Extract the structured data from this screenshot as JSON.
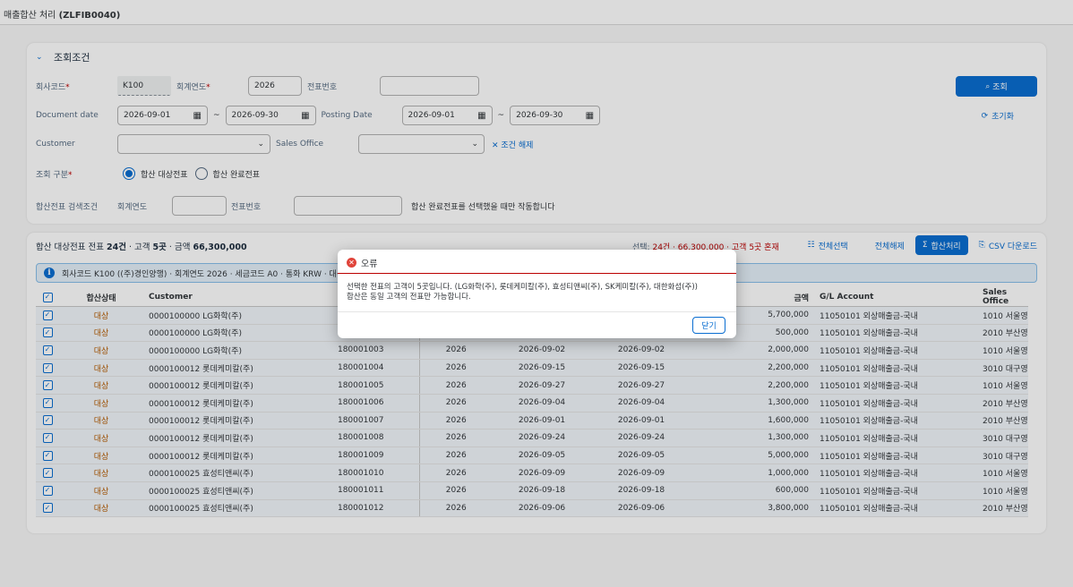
{
  "app": {
    "title_prefix": "매출합산 처리 ",
    "title_code": "(ZLFIB0040)"
  },
  "filter": {
    "section_title": "조회조건",
    "company_code": {
      "label": "회사코드",
      "value": "K100"
    },
    "fiscal_year": {
      "label": "회계연도",
      "value": "2026"
    },
    "doc_number": {
      "label": "전표번호",
      "value": ""
    },
    "document_date": {
      "label": "Document date",
      "from": "2026-09-01",
      "to": "2026-09-30"
    },
    "posting_date": {
      "label": "Posting Date",
      "from": "2026-09-01",
      "to": "2026-09-30"
    },
    "customer": {
      "label": "Customer",
      "value": ""
    },
    "sales_office": {
      "label": "Sales Office",
      "value": ""
    },
    "clear_label": "조건 해제",
    "inquiry_type": {
      "label": "조회 구분",
      "option1": "합산 대상전표",
      "option2": "합산 완료전표",
      "selected": "합산 대상전표"
    },
    "summed_search": {
      "label": "합산전표 검색조건",
      "year_label": "회계연도",
      "doc_label": "전표번호",
      "hint": "합산 완료전표를 선택했을 때만 작동합니다"
    },
    "search_button": "조회",
    "reset_button": "초기화"
  },
  "table": {
    "title": "합산 대상전표",
    "summary_prefix": "전표 ",
    "summary_count": "24건",
    "summary_mid": " · 고객 ",
    "summary_customers": "5곳",
    "summary_amount_prefix": " · 금액 ",
    "summary_amount": "66,300,000",
    "selection_prefix": "선택: ",
    "selection_detail": "24건 · 66,300,000 · 고객 5곳 혼재",
    "select_all": "전체선택",
    "deselect_all": "전체해제",
    "sum_process": "합산처리",
    "csv_download": "CSV 다운로드",
    "info_text": "회사코드 K100 ((주)경인양행) · 회계연도 2026 · 세금코드 A0 · 통화 KRW · 대상",
    "columns": [
      "합산상태",
      "Customer",
      "",
      "",
      "",
      "",
      "금액",
      "G/L Account",
      "Sales Office"
    ],
    "rows": [
      {
        "status": "대상",
        "customer": "0000100000 LG화학(주)",
        "doc": "",
        "year": "",
        "doc_date": "",
        "post_date": "",
        "amount": "5,700,000",
        "gl": "11050101 외상매출금-국내",
        "office": "1010 서울영"
      },
      {
        "status": "대상",
        "customer": "0000100000 LG화학(주)",
        "doc": "",
        "year": "",
        "doc_date": "",
        "post_date": "",
        "amount": "500,000",
        "gl": "11050101 외상매출금-국내",
        "office": "2010 부산영"
      },
      {
        "status": "대상",
        "customer": "0000100000 LG화학(주)",
        "doc": "180001003",
        "year": "2026",
        "doc_date": "2026-09-02",
        "post_date": "2026-09-02",
        "amount": "2,000,000",
        "gl": "11050101 외상매출금-국내",
        "office": "1010 서울영"
      },
      {
        "status": "대상",
        "customer": "0000100012 롯데케미칼(주)",
        "doc": "180001004",
        "year": "2026",
        "doc_date": "2026-09-15",
        "post_date": "2026-09-15",
        "amount": "2,200,000",
        "gl": "11050101 외상매출금-국내",
        "office": "3010 대구영"
      },
      {
        "status": "대상",
        "customer": "0000100012 롯데케미칼(주)",
        "doc": "180001005",
        "year": "2026",
        "doc_date": "2026-09-27",
        "post_date": "2026-09-27",
        "amount": "2,200,000",
        "gl": "11050101 외상매출금-국내",
        "office": "1010 서울영"
      },
      {
        "status": "대상",
        "customer": "0000100012 롯데케미칼(주)",
        "doc": "180001006",
        "year": "2026",
        "doc_date": "2026-09-04",
        "post_date": "2026-09-04",
        "amount": "1,300,000",
        "gl": "11050101 외상매출금-국내",
        "office": "2010 부산영"
      },
      {
        "status": "대상",
        "customer": "0000100012 롯데케미칼(주)",
        "doc": "180001007",
        "year": "2026",
        "doc_date": "2026-09-01",
        "post_date": "2026-09-01",
        "amount": "1,600,000",
        "gl": "11050101 외상매출금-국내",
        "office": "2010 부산영"
      },
      {
        "status": "대상",
        "customer": "0000100012 롯데케미칼(주)",
        "doc": "180001008",
        "year": "2026",
        "doc_date": "2026-09-24",
        "post_date": "2026-09-24",
        "amount": "1,300,000",
        "gl": "11050101 외상매출금-국내",
        "office": "3010 대구영"
      },
      {
        "status": "대상",
        "customer": "0000100012 롯데케미칼(주)",
        "doc": "180001009",
        "year": "2026",
        "doc_date": "2026-09-05",
        "post_date": "2026-09-05",
        "amount": "5,000,000",
        "gl": "11050101 외상매출금-국내",
        "office": "3010 대구영"
      },
      {
        "status": "대상",
        "customer": "0000100025 효성티앤씨(주)",
        "doc": "180001010",
        "year": "2026",
        "doc_date": "2026-09-09",
        "post_date": "2026-09-09",
        "amount": "1,000,000",
        "gl": "11050101 외상매출금-국내",
        "office": "1010 서울영"
      },
      {
        "status": "대상",
        "customer": "0000100025 효성티앤씨(주)",
        "doc": "180001011",
        "year": "2026",
        "doc_date": "2026-09-18",
        "post_date": "2026-09-18",
        "amount": "600,000",
        "gl": "11050101 외상매출금-국내",
        "office": "1010 서울영"
      },
      {
        "status": "대상",
        "customer": "0000100025 효성티앤씨(주)",
        "doc": "180001012",
        "year": "2026",
        "doc_date": "2026-09-06",
        "post_date": "2026-09-06",
        "amount": "3,800,000",
        "gl": "11050101 외상매출금-국내",
        "office": "2010 부산영"
      }
    ]
  },
  "dialog": {
    "title": "오류",
    "line1": "선택한 전표의 고객이 5곳입니다. (LG화학(주), 롯데케미칼(주), 효성티앤씨(주), SK케미칼(주), 대한화섬(주))",
    "line2": "합산은 동일 고객의 전표만 가능합니다.",
    "close_label": "닫기"
  },
  "icons": {
    "chevron": "chevron-down-icon",
    "calendar": "calendar-icon",
    "search": "search-icon",
    "reset": "reset-icon",
    "error": "error-icon",
    "info": "info-icon"
  },
  "colors": {
    "accent": "#0a6ed1",
    "error": "#bb0000",
    "status_target": "#b55b00"
  }
}
